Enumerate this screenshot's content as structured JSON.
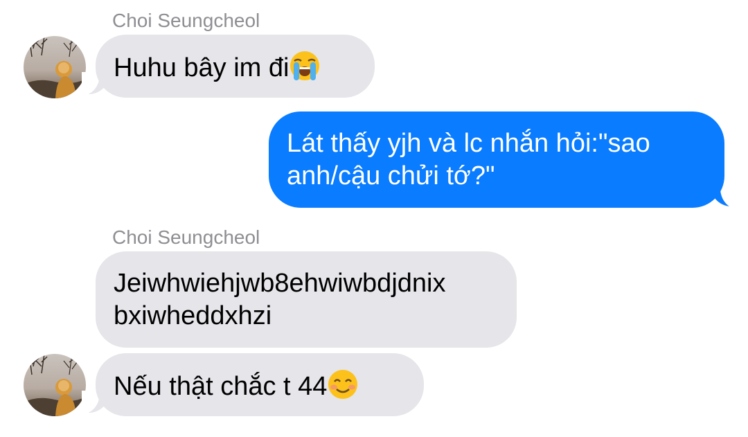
{
  "conversation": {
    "messages": [
      {
        "sender": "Choi Seungcheol",
        "text": "Huhu bây im đi",
        "emoji": "loudly-crying-face-emoji"
      },
      {
        "sender": "me",
        "lines": [
          "Lát thấy yjh và lc nhắn hỏi:\"sao",
          "anh/cậu chửi tớ?\""
        ]
      },
      {
        "sender": "Choi Seungcheol",
        "lines": [
          "Jeiwhwiehjwb8ehwiwbdjdnix",
          "bxiwheddxhzi"
        ]
      },
      {
        "sender": "Choi Seungcheol",
        "text": "Nếu thật chắc t 44",
        "emoji": "smiling-face-with-smiling-eyes-emoji"
      }
    ]
  },
  "colors": {
    "incoming_bubble": "#e5e5ea",
    "outgoing_bubble": "#0a7cff",
    "sender_name": "#8e8e93"
  }
}
